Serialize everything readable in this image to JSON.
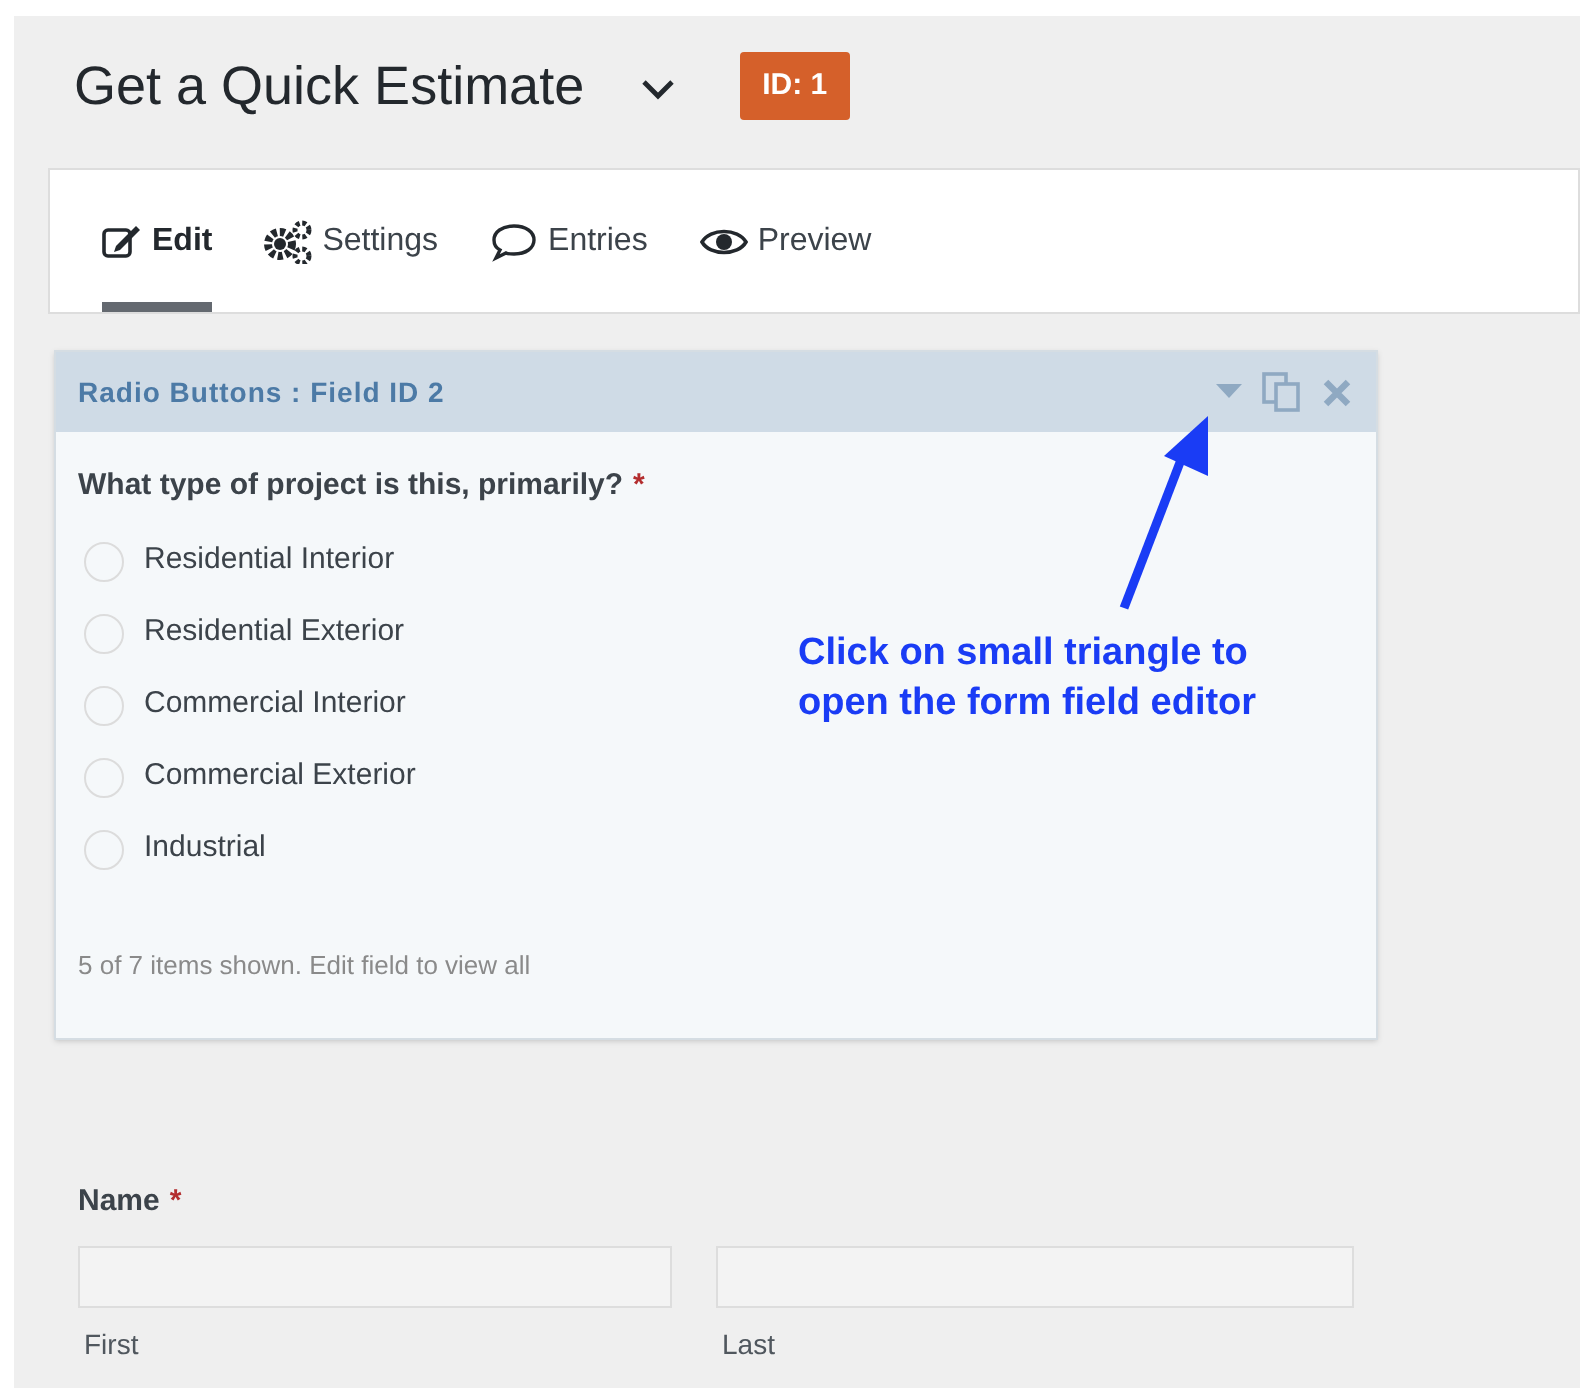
{
  "title": "Get a Quick Estimate",
  "id_badge": "ID: 1",
  "tabs": [
    {
      "kind": "edit",
      "label": "Edit",
      "selected": true
    },
    {
      "kind": "settings",
      "label": "Settings",
      "selected": false
    },
    {
      "kind": "entries",
      "label": "Entries",
      "selected": false
    },
    {
      "kind": "preview",
      "label": "Preview",
      "selected": false
    }
  ],
  "field": {
    "header": "Radio Buttons : Field ID 2",
    "question": "What type of project is this, primarily?",
    "required_mark": "*",
    "options": [
      {
        "label": "Residential Interior",
        "selected": false
      },
      {
        "label": "Residential Exterior",
        "selected": false
      },
      {
        "label": "Commercial Interior",
        "selected": false
      },
      {
        "label": "Commercial Exterior",
        "selected": false
      },
      {
        "label": "Industrial",
        "selected": false
      }
    ],
    "note": "5 of 7 items shown. Edit field to view all"
  },
  "annotation": {
    "lines": [
      "Click on small triangle to",
      "open the form field editor"
    ]
  },
  "name_field": {
    "label": "Name",
    "required_mark": "*",
    "inputs": [
      {
        "sublabel": "First"
      },
      {
        "sublabel": "Last"
      }
    ]
  }
}
